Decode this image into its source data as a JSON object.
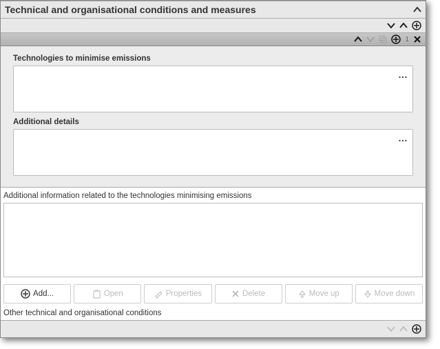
{
  "section": {
    "title": "Technical and organisational conditions and measures"
  },
  "strip": {
    "item_count": "1"
  },
  "fields": {
    "tech_label": "Technologies to minimise emissions",
    "addl_label": "Additional details"
  },
  "addl_info_label": "Additional information related to the technologies minimising emissions",
  "buttons": {
    "add": "Add...",
    "open": "Open",
    "properties": "Properties",
    "delete": "Delete",
    "move_up": "Move up",
    "move_down": "Move down"
  },
  "other_label": "Other technical and organisational conditions"
}
